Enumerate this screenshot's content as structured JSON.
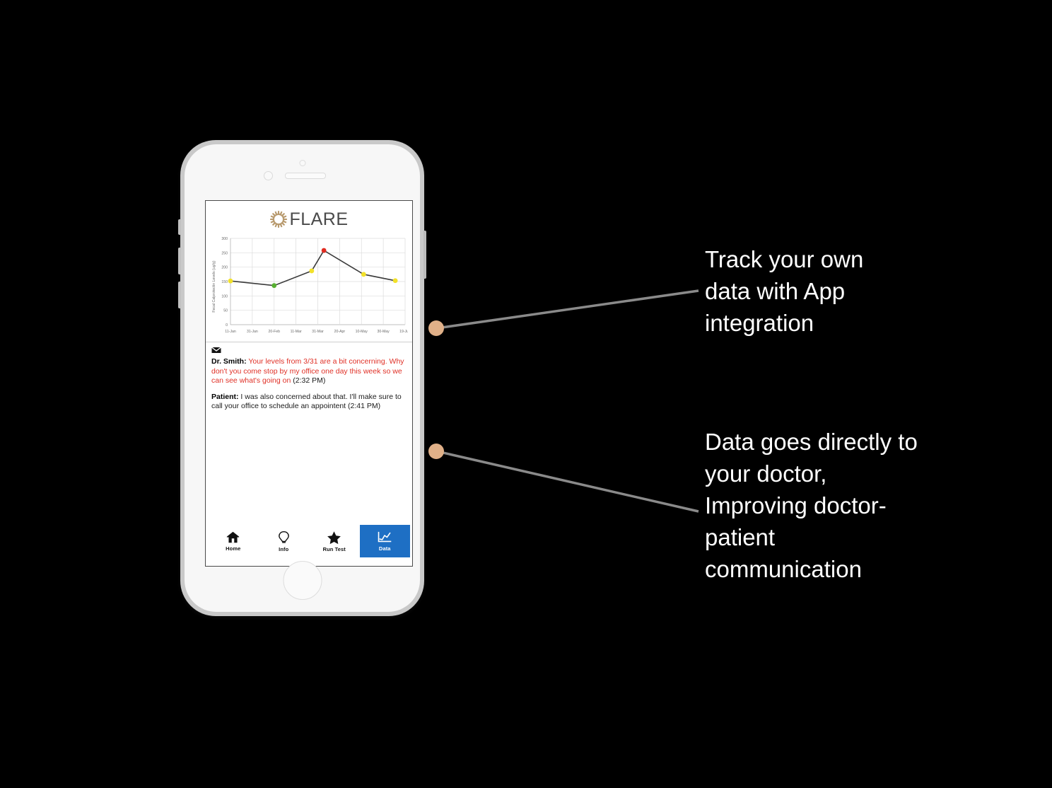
{
  "device": {
    "name": "smartphone-mockup",
    "frame_color": "#c9c9c9",
    "body_color": "#f7f7f7"
  },
  "app": {
    "title": "FLARE",
    "logo_icon": "gear-sun-icon",
    "logo_color": "#b89a6e",
    "title_color": "#4a4a4a"
  },
  "chart_data": {
    "type": "line",
    "title": "",
    "xlabel": "",
    "ylabel": "Fecal Calprotectin Levels (ug/g)",
    "ylim": [
      0,
      300
    ],
    "yticks": [
      0,
      50,
      100,
      150,
      200,
      250,
      300
    ],
    "xticks": [
      "11-Jan",
      "31-Jan",
      "20-Feb",
      "11-Mar",
      "31-Mar",
      "20-Apr",
      "10-May",
      "30-May",
      "19-Jun"
    ],
    "grid": true,
    "legend": "none",
    "line_color": "#3a3a3a",
    "points": [
      {
        "x": "11-Jan",
        "y": 152,
        "color": "#f2e12a",
        "status": "yellow"
      },
      {
        "x": "20-Feb",
        "y": 136,
        "color": "#57b031",
        "status": "green"
      },
      {
        "x": "25-Mar",
        "y": 187,
        "color": "#f2e12a",
        "status": "yellow"
      },
      {
        "x": "31-Mar",
        "y": 258,
        "color": "#e02b20",
        "status": "red"
      },
      {
        "x": "05-May",
        "y": 175,
        "color": "#f2e12a",
        "status": "yellow"
      },
      {
        "x": "30-May",
        "y": 153,
        "color": "#f2e12a",
        "status": "yellow"
      }
    ]
  },
  "messages": {
    "icon": "envelope-icon",
    "alert_color": "#e03127",
    "items": [
      {
        "sender": "Dr. Smith:",
        "body": " Your levels from 3/31 are a bit concerning. Why don't you come stop by my office one day this week so we can see what's going on",
        "time": " (2:32 PM)",
        "highlight": true
      },
      {
        "sender": "Patient:",
        "body": " I was also concerned about that. I'll make sure to call your office to schedule an appointent",
        "time": " (2:41 PM)",
        "highlight": false
      }
    ]
  },
  "bottom_nav": {
    "active_color": "#1e6fc4",
    "items": [
      {
        "label": "Home",
        "icon": "home-icon",
        "active": false
      },
      {
        "label": "Info",
        "icon": "lightbulb-icon",
        "active": false
      },
      {
        "label": "Run Test",
        "icon": "star-icon",
        "active": false
      },
      {
        "label": "Data",
        "icon": "line-chart-icon",
        "active": true
      }
    ]
  },
  "callouts": {
    "dot_color": "#e0b088",
    "line_color": "#8a8a8a",
    "items": [
      {
        "text": "Track your own\ndata with App\nintegration"
      },
      {
        "text": "Data goes directly to\nyour doctor,\nImproving doctor-\npatient\ncommunication"
      }
    ]
  }
}
